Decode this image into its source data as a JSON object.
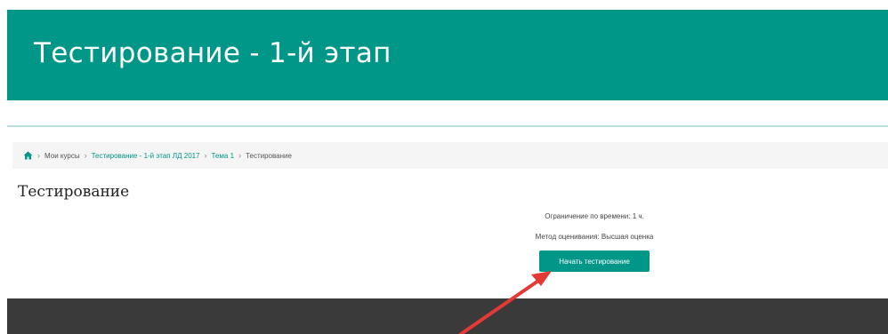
{
  "header": {
    "title": "Тестирование - 1-й этап"
  },
  "breadcrumb": {
    "items": [
      {
        "label": "Мои курсы",
        "link": false
      },
      {
        "label": "Тестирование - 1-й этап ЛД 2017",
        "link": true
      },
      {
        "label": "Тема 1",
        "link": true
      },
      {
        "label": "Тестирование",
        "link": false
      }
    ],
    "separator": "›"
  },
  "main": {
    "title": "Тестирование",
    "time_limit": "Ограничение по времени: 1 ч.",
    "grading_method": "Метод оценивания: Высшая оценка",
    "start_button": "Начать тестирование"
  },
  "colors": {
    "accent": "#009688",
    "footer": "#3a3a3a",
    "annotation_arrow": "#e53935"
  },
  "icons": {
    "home": "home-icon"
  }
}
